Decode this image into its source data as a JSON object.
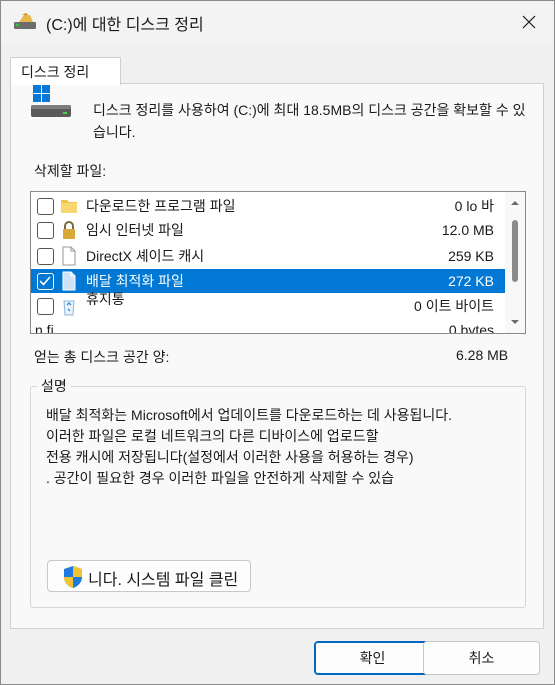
{
  "window": {
    "title": "(C:)에 대한 디스크 정리",
    "close_icon": "close-icon"
  },
  "tab": {
    "label": "디스크 정리"
  },
  "intro": {
    "text": "디스크 정리를 사용하여 (C:)에 최대 18.5MB의 디스크 공간을 확보할 수 있습니다."
  },
  "files": {
    "label": "삭제할 파일:",
    "items": [
      {
        "name": "다운로드한 프로그램 파일",
        "size": "0 lo 바",
        "checked": false,
        "icon": "folder-icon"
      },
      {
        "name": "임시 인터넷 파일",
        "size": "12.0 MB",
        "checked": false,
        "icon": "lock-icon"
      },
      {
        "name": "DirectX 셰이드 캐시",
        "size": "259 KB",
        "checked": false,
        "icon": "file-icon"
      },
      {
        "name": "배달 최적화 파일",
        "size": "272 KB",
        "checked": true,
        "icon": "file-icon",
        "selected": true
      },
      {
        "name": "휴지통",
        "size": "0 이트 바이트",
        "checked": false,
        "icon": "recycle-bin-icon"
      },
      {
        "name": "n fi",
        "size": "0 bytes",
        "checked": false,
        "icon": ""
      }
    ]
  },
  "total": {
    "label": "얻는 총 디스크 공간 양:",
    "value": "6.28 MB"
  },
  "description": {
    "title": "설명",
    "lines": [
      "배달 최적화는 Microsoft에서 업데이트를 다운로드하는 데 사용됩니다.",
      "이러한 파일은 로컬 네트워크의 다른 디바이스에 업로드할",
      "전용 캐시에 저장됩니다(설정에서 이러한 사용을 허용하는 경우)",
      ". 공간이 필요한 경우 이러한 파일을 안전하게 삭제할 수 있습"
    ]
  },
  "cleanup_button": {
    "label": "니다. 시스템 파일 클린"
  },
  "buttons": {
    "ok": "확인",
    "cancel": "취소"
  }
}
